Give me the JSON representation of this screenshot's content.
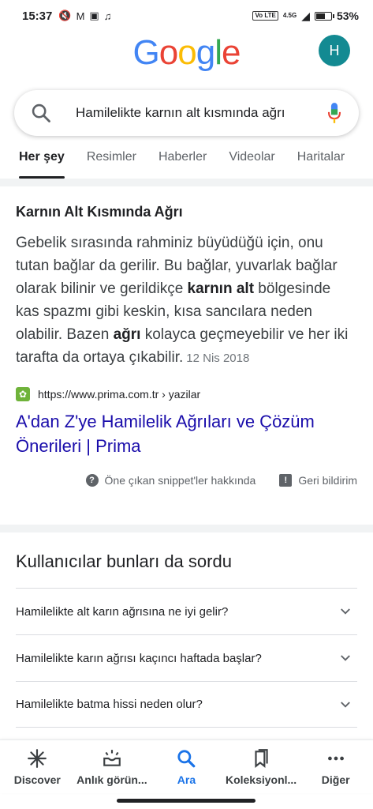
{
  "status_bar": {
    "time": "15:37",
    "left_icons": [
      "mute-icon",
      "gmail-icon",
      "gallery-icon",
      "tiktok-icon"
    ],
    "volte": "Vo LTE",
    "network": "4.5G",
    "battery": "53%",
    "battery_level": 0.53
  },
  "header": {
    "logo": [
      "G",
      "o",
      "o",
      "g",
      "l",
      "e"
    ],
    "logo_colors": [
      "#4285F4",
      "#EA4335",
      "#FBBC05",
      "#4285F4",
      "#34A853",
      "#EA4335"
    ],
    "avatar_letter": "H",
    "avatar_color": "#138a92"
  },
  "search": {
    "query": "Hamilelikte karnın alt kısmında ağrı"
  },
  "tabs": [
    {
      "label": "Her şey",
      "active": true
    },
    {
      "label": "Resimler",
      "active": false
    },
    {
      "label": "Haberler",
      "active": false
    },
    {
      "label": "Videolar",
      "active": false
    },
    {
      "label": "Haritalar",
      "active": false
    }
  ],
  "snippet": {
    "title": "Karnın Alt Kısmında Ağrı",
    "body_1": "Gebelik sırasında rahminiz büyüdüğü için, onu tutan bağlar da gerilir. Bu bağlar, yuvarlak bağlar olarak bilinir ve gerildikçe ",
    "body_bold_1": "karnın alt",
    "body_2": " bölgesinde kas spazmı gibi keskin, kısa sancılara neden olabilir. Bazen ",
    "body_bold_2": "ağrı",
    "body_3": " kolayca geçmeyebilir ve her iki tarafta da ortaya çıkabilir.",
    "date": "12 Nis 2018",
    "source_url": "https://www.prima.com.tr › yazilar",
    "link_title": "A'dan Z'ye Hamilelik Ağrıları ve Çözüm Önerileri | Prima",
    "about_label": "Öne çıkan snippet'ler hakkında",
    "feedback_label": "Geri bildirim"
  },
  "paa": {
    "title": "Kullanıcılar bunları da sordu",
    "questions": [
      "Hamilelikte alt karın ağrısına ne iyi gelir?",
      "Hamilelikte karın ağrısı kaçıncı haftada başlar?",
      "Hamilelikte batma hissi neden olur?"
    ]
  },
  "bottom_nav": [
    {
      "label": "Discover",
      "icon": "asterisk-icon",
      "active": false
    },
    {
      "label": "Anlık görün...",
      "icon": "updates-tray-icon",
      "active": false
    },
    {
      "label": "Ara",
      "icon": "search-icon",
      "active": true
    },
    {
      "label": "Koleksiyonl...",
      "icon": "bookmarks-icon",
      "active": false
    },
    {
      "label": "Diğer",
      "icon": "more-dots-icon",
      "active": false
    }
  ],
  "colors": {
    "link": "#1a0dab",
    "active_nav": "#1a73e8",
    "favicon": "#6fb33a"
  }
}
